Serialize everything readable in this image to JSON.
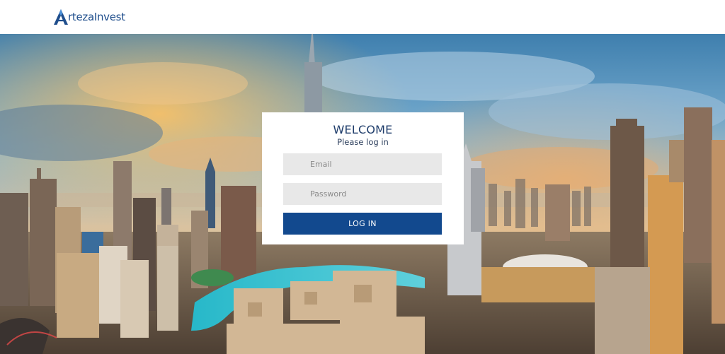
{
  "header": {
    "logo_text": "rtezaInvest",
    "logo_letter": "A",
    "brand_color": "#1f4e8c"
  },
  "hero": {
    "image": "dubai-skyline-photo"
  },
  "login": {
    "title": "WELCOME",
    "subtitle": "Please log in",
    "email_placeholder": "Email",
    "password_placeholder": "Password",
    "button_label": "LOG IN",
    "button_color": "#12498e",
    "field_background": "#e8e8e8"
  }
}
